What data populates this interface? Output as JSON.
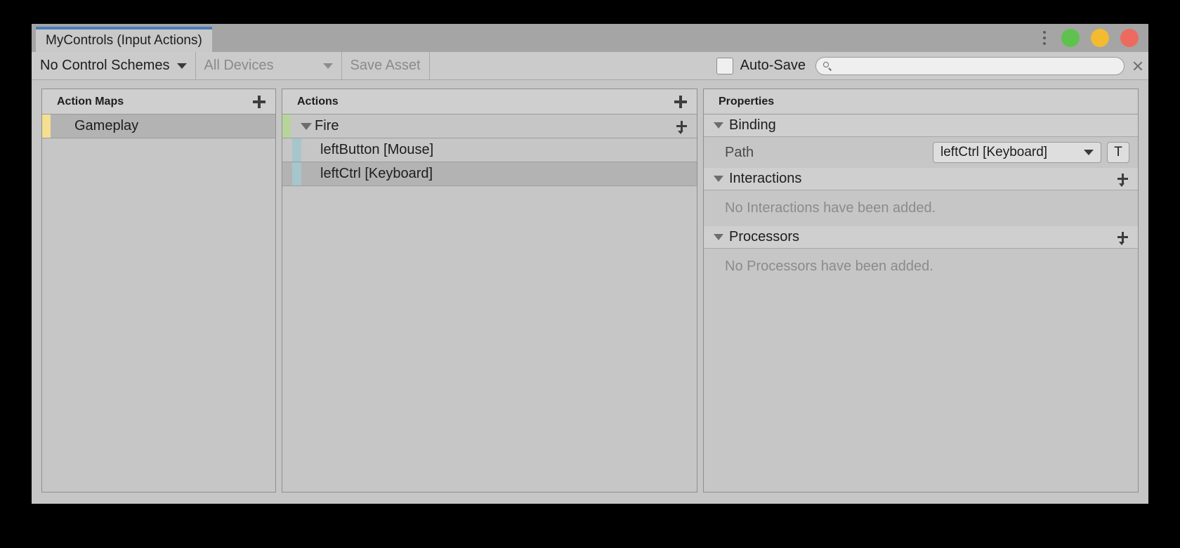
{
  "window": {
    "tab_label": "MyControls (Input Actions)",
    "accent_color": "#4a7ebb",
    "controls": {
      "kebab_icon": "vertical-ellipsis-icon",
      "minimize_color": "#5fc24e",
      "maximize_color": "#f2bb30",
      "close_color": "#ed6a5e"
    }
  },
  "toolbar": {
    "control_schemes_label": "No Control Schemes",
    "devices_label": "All Devices",
    "save_asset_label": "Save Asset",
    "auto_save_label": "Auto-Save",
    "auto_save_checked": false,
    "search_value": "",
    "search_placeholder": "",
    "search_icon": "search-icon",
    "clear_icon": "close-icon"
  },
  "action_maps": {
    "title": "Action Maps",
    "add_label": "+",
    "items": [
      {
        "label": "Gameplay",
        "stripe": "yellow",
        "selected": true
      }
    ]
  },
  "actions": {
    "title": "Actions",
    "add_label": "+",
    "items": [
      {
        "label": "Fire",
        "type": "action",
        "stripe": "green",
        "expanded": true,
        "selected": false,
        "bindings": [
          {
            "label": "leftButton [Mouse]",
            "type": "binding",
            "stripe": "teal",
            "selected": false
          },
          {
            "label": "leftCtrl [Keyboard]",
            "type": "binding",
            "stripe": "teal",
            "selected": true
          }
        ]
      }
    ]
  },
  "properties": {
    "title": "Properties",
    "binding": {
      "section_label": "Binding",
      "expanded": true,
      "path_label": "Path",
      "path_value": "leftCtrl [Keyboard]",
      "path_button_label": "T"
    },
    "interactions": {
      "section_label": "Interactions",
      "expanded": true,
      "empty_text": "No Interactions have been added."
    },
    "processors": {
      "section_label": "Processors",
      "expanded": true,
      "empty_text": "No Processors have been added."
    }
  }
}
